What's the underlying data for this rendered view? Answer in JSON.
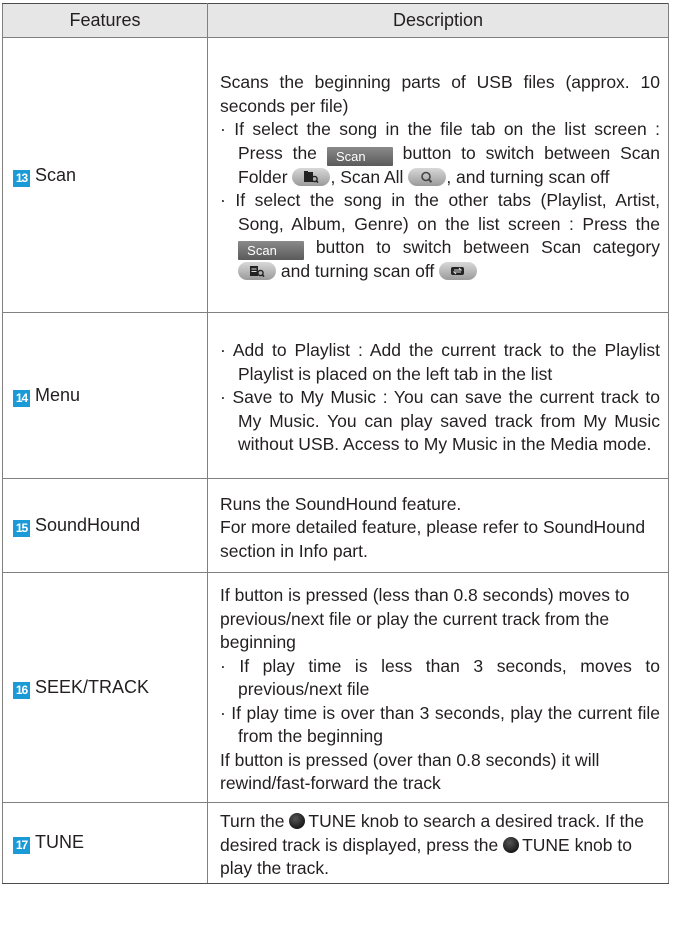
{
  "header": {
    "col_features": "Features",
    "col_description": "Description"
  },
  "rows": [
    {
      "number": "13",
      "feature": "Scan",
      "line1": "Scans the beginning parts of USB files (approx. 10 seconds per file)",
      "b1_a": "· If select the song in the file tab on the list screen : Press the",
      "b1_b": "button to switch between Scan Folder",
      "b1_c": ", Scan All",
      "b1_d": ", and turning scan off",
      "b2_a": "· If select the song in the other tabs (Playlist, Artist, Song, Album, Genre) on the list screen : Press the",
      "b2_b": "button to switch between Scan category",
      "b2_c": "and turning scan off",
      "scan_button_label": "Scan"
    },
    {
      "number": "14",
      "feature": "Menu",
      "b1": "· Add to Playlist : Add the current track to the Playlist Playlist is placed on the left tab in the list",
      "b2": "· Save to My Music : You can save the current track to My Music. You can play saved track from My Music without USB.  Access to My Music in the Media mode."
    },
    {
      "number": "15",
      "feature": "SoundHound",
      "line1": "Runs the SoundHound feature.",
      "line2": "For more detailed feature, please refer to SoundHound section in Info part."
    },
    {
      "number": "16",
      "feature": "SEEK/TRACK",
      "line1": "If button is pressed (less than 0.8 seconds) moves to previous/next file or play the current track from the beginning",
      "b1": "· If play time is less than 3 seconds, moves to previous/next file",
      "b2": "· If play time is over than 3 seconds, play the current file from the beginning",
      "line2": "If button is pressed (over than 0.8 seconds) it will rewind/fast-forward the track"
    },
    {
      "number": "17",
      "feature": "TUNE",
      "line1": "Turn the",
      "line1_b": "TUNE knob to search a desired track. If the desired track is displayed, press the",
      "line2_b": "TUNE knob to play the track."
    }
  ],
  "icons": {
    "badge_color": "#1a9bd7",
    "scan_folder": "scan-folder-icon",
    "scan_all": "scan-all-icon",
    "scan_category": "scan-category-icon",
    "scan_off": "scan-off-icon",
    "tune_knob": "tune-knob-icon"
  }
}
